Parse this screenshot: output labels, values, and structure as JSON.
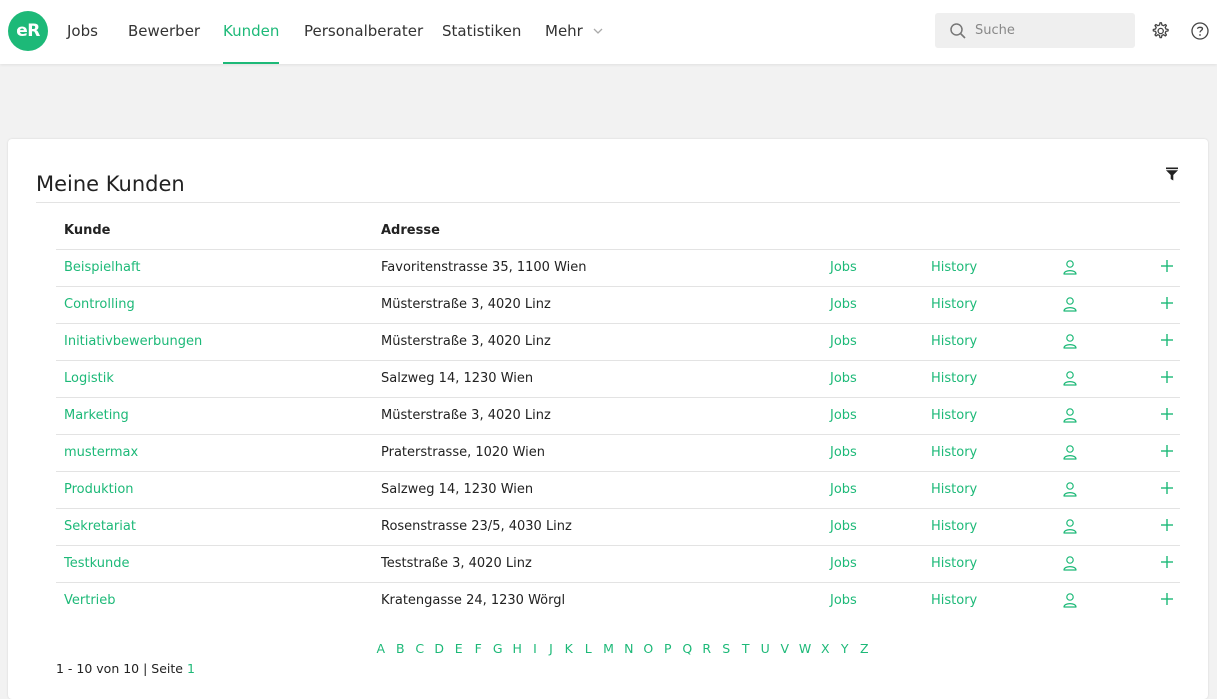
{
  "header": {
    "logo": "eR",
    "nav": [
      {
        "label": "Jobs",
        "active": false
      },
      {
        "label": "Bewerber",
        "active": false
      },
      {
        "label": "Kunden",
        "active": true
      },
      {
        "label": "Personalberater",
        "active": false
      },
      {
        "label": "Statistiken",
        "active": false
      },
      {
        "label": "Mehr",
        "active": false
      }
    ],
    "search": {
      "placeholder": "Suche",
      "value": ""
    }
  },
  "main": {
    "title": "Meine Kunden",
    "columns": {
      "kunde": "Kunde",
      "adresse": "Adresse"
    },
    "jobs_label": "Jobs",
    "history_label": "History",
    "rows": [
      {
        "name": "Beispielhaft",
        "address": "Favoritenstrasse 35, 1100 Wien"
      },
      {
        "name": "Controlling",
        "address": "Müsterstraße 3, 4020 Linz"
      },
      {
        "name": "Initiativbewerbungen",
        "address": "Müsterstraße 3, 4020 Linz"
      },
      {
        "name": "Logistik",
        "address": "Salzweg 14, 1230 Wien"
      },
      {
        "name": "Marketing",
        "address": "Müsterstraße 3, 4020 Linz"
      },
      {
        "name": "mustermax",
        "address": "Praterstrasse, 1020 Wien"
      },
      {
        "name": "Produktion",
        "address": "Salzweg 14, 1230 Wien"
      },
      {
        "name": "Sekretariat",
        "address": "Rosenstrasse 23/5, 4030 Linz"
      },
      {
        "name": "Testkunde",
        "address": "Teststraße 3, 4020 Linz"
      },
      {
        "name": "Vertrieb",
        "address": "Kratengasse 24, 1230 Wörgl"
      }
    ],
    "alphabet": [
      "A",
      "B",
      "C",
      "D",
      "E",
      "F",
      "G",
      "H",
      "I",
      "J",
      "K",
      "L",
      "M",
      "N",
      "O",
      "P",
      "Q",
      "R",
      "S",
      "T",
      "U",
      "V",
      "W",
      "X",
      "Y",
      "Z"
    ],
    "pagination": {
      "range": "1 - 10 von 10",
      "separator": " | Seite ",
      "page": "1"
    }
  },
  "colors": {
    "accent": "#1db978",
    "background": "#f2f2f2"
  }
}
